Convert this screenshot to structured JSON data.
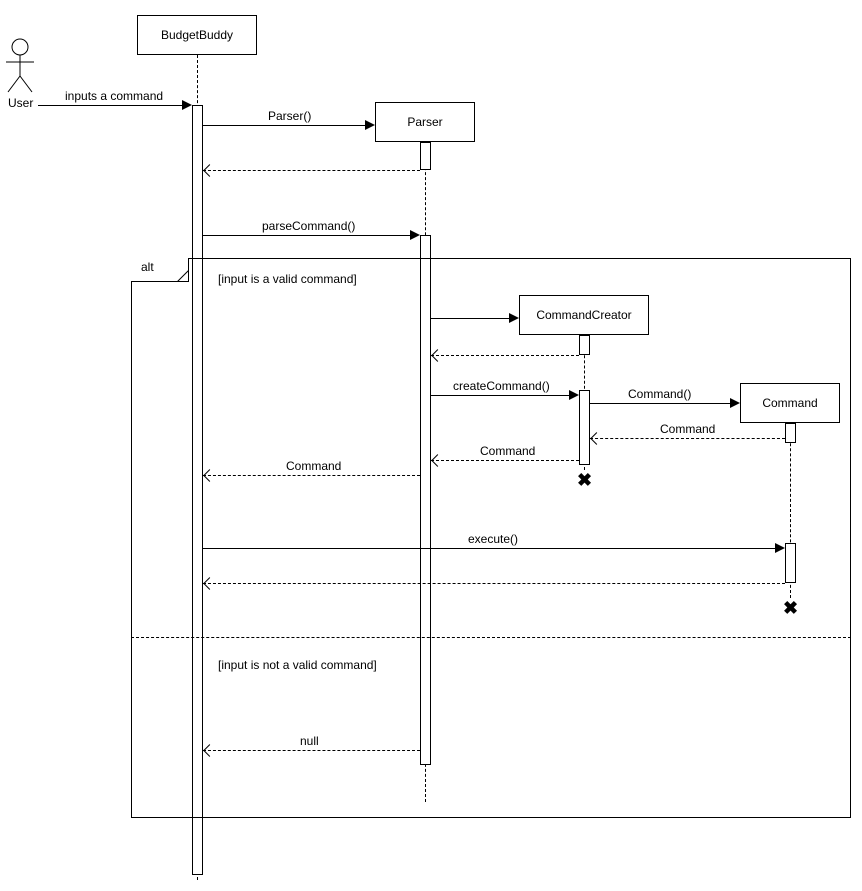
{
  "actor": {
    "label": "User"
  },
  "lifelines": {
    "budgetBuddy": "BudgetBuddy",
    "parser": "Parser",
    "commandCreator": "CommandCreator",
    "command": "Command"
  },
  "messages": {
    "inputsCommand": "inputs a command",
    "parserCtor": "Parser()",
    "parseCommand": "parseCommand()",
    "createCommand": "createCommand()",
    "commandCtor": "Command()",
    "commandReturn1": "Command",
    "commandReturn2": "Command",
    "commandReturn3": "Command",
    "execute": "execute()",
    "null": "null"
  },
  "fragment": {
    "type": "alt",
    "guard1": "[input is a valid command]",
    "guard2": "[input is not a valid command]"
  }
}
